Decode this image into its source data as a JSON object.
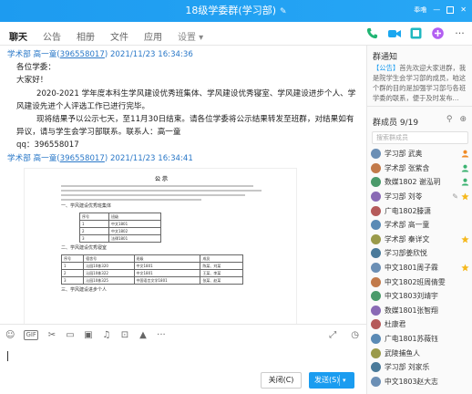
{
  "window": {
    "title": "18级学委群(学习部)",
    "title_edit_icon": "pencil-icon",
    "controls": [
      "feather-icon",
      "minimize-icon",
      "maximize-icon",
      "close-icon"
    ],
    "control_glyph_1": "奉噜"
  },
  "tabs": {
    "items": [
      "聊天",
      "公告",
      "相册",
      "文件",
      "应用"
    ],
    "more": "设置 ▾"
  },
  "toolbar_icons": [
    "phone-icon",
    "video-icon",
    "screen-share-icon",
    "add-app-icon",
    "more-icon"
  ],
  "messages": [
    {
      "sender": "学术部 高一童",
      "qq": "396558017",
      "time": "2021/11/23 16:34:36",
      "lines": [
        "各位学委：",
        "大家好！",
        "2020-2021 学年度本科生学风建设优秀班集体、学风建设优秀寝室、学风建设进步个人、学风建设先进个人评选工作已进行完毕。",
        "现将结果予以公示七天，至11月30日结束。请各位学委将公示结果转发至班群，对结果如有异议，请与学生会学习部联系。联系人：高一童",
        "qq：396558017"
      ]
    },
    {
      "sender": "学术部 高一童",
      "qq": "396558017",
      "time": "2021/11/23 16:34:41",
      "image": {
        "heading": "公 示",
        "sections": [
          "一、学风建设优秀班集体",
          "二、学风建设优秀寝室",
          "三、学风建设进步个人"
        ],
        "table1": [
          [
            "序号",
            "班级"
          ],
          [
            "1",
            "中文1801"
          ],
          [
            "2",
            "中文1802"
          ],
          [
            "3",
            "法律1801"
          ]
        ],
        "table2": [
          [
            "序号",
            "宿舍号",
            "班级",
            "成员"
          ],
          [
            "1",
            "沁园10栋320",
            "中文1801",
            "陈某、刘某"
          ],
          [
            "2",
            "沁园10栋322",
            "中文1801",
            "王某、李某"
          ],
          [
            "3",
            "沁园10栋325",
            "中国语言文学1801",
            "张某、赵某"
          ]
        ]
      }
    }
  ],
  "input_tools": [
    "emoji-icon",
    "GIF",
    "scissors-icon",
    "folder-icon",
    "image-icon",
    "music-icon",
    "screenshot-icon",
    "bell-icon",
    "more-icon"
  ],
  "input_right_tools": [
    "expand-icon",
    "history-icon"
  ],
  "buttons": {
    "close": "关闭(C)",
    "send": "发送(S)",
    "send_arrow": "▾"
  },
  "notice": {
    "title": "群通知",
    "tag": "【公告】",
    "body": "首先欢迎大家进群，我是院学生会学习部的成员，咱这个群的目的是加强学习部与各班学委的联系，便于及时发布..."
  },
  "members": {
    "title": "群成员",
    "count": "9/19",
    "search_placeholder": "搜索群成员",
    "list": [
      {
        "name": "学习部  武奥",
        "role": "owner"
      },
      {
        "name": "学术部 张紫含",
        "role": "admin"
      },
      {
        "name": "数媒1802 谢泓玥",
        "role": "admin"
      },
      {
        "name": "学习部  刘苓",
        "role": "star",
        "edit": true
      },
      {
        "name": "广电1802滕潇"
      },
      {
        "name": "学术部 高一童"
      },
      {
        "name": "学术部 秦详文",
        "role": "star"
      },
      {
        "name": "学习部姜欣悦"
      },
      {
        "name": "中文1801周子霖",
        "role": "star"
      },
      {
        "name": "中文1802班周倩雯"
      },
      {
        "name": "中文1803刘靖宇"
      },
      {
        "name": "数媒1801张智翔"
      },
      {
        "name": "杜康君"
      },
      {
        "name": "广电1801苏薇钰"
      },
      {
        "name": "武陵捕鱼人"
      },
      {
        "name": "学习部 刘家乐"
      },
      {
        "name": "中文1803赵大志"
      }
    ]
  },
  "colors": {
    "accent": "#1a9cf0",
    "link": "#2a78c8"
  }
}
